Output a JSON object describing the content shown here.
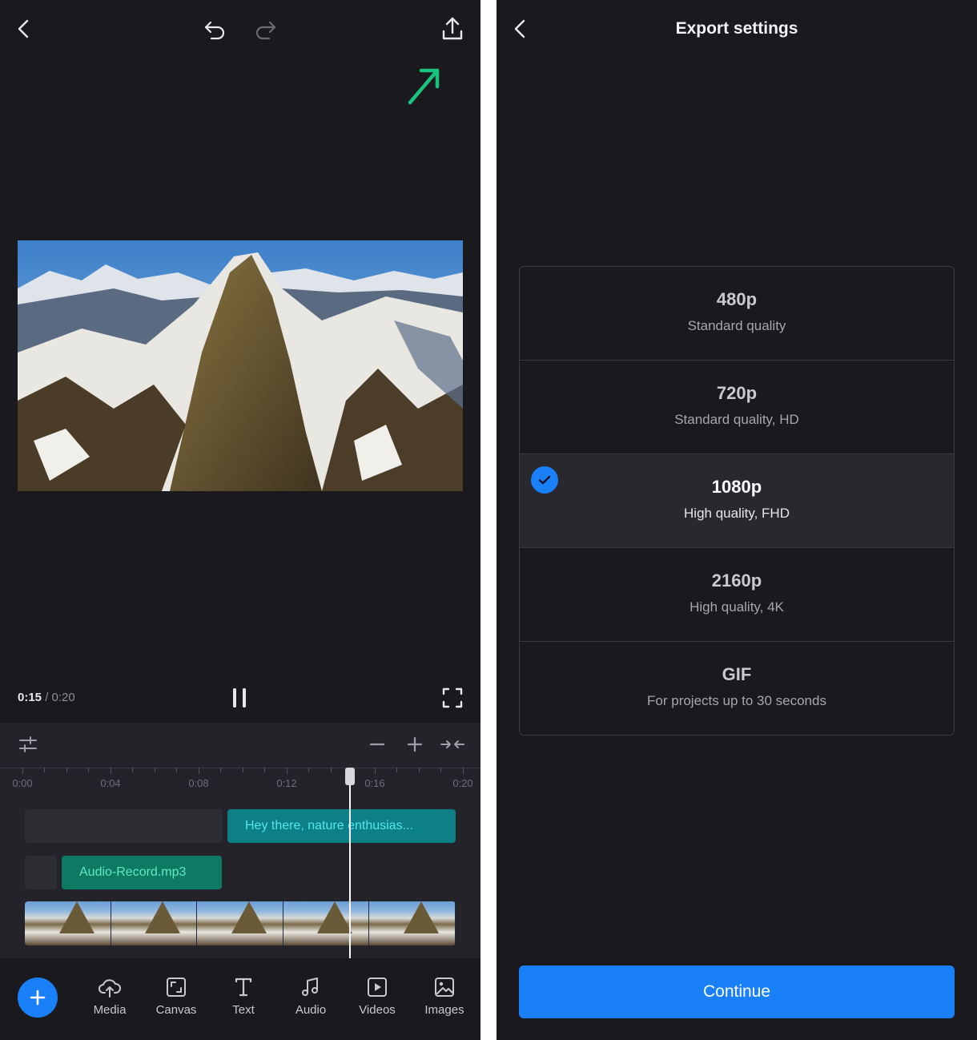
{
  "editor": {
    "time": {
      "current": "0:15",
      "separator": " / ",
      "total": "0:20"
    },
    "ruler": [
      "0:00",
      "0:04",
      "0:08",
      "0:12",
      "0:16",
      "0:20"
    ],
    "tracks": {
      "text_clip": "Hey there, nature enthusias...",
      "audio_clip": "Audio-Record.mp3"
    },
    "nav": [
      {
        "label": "Media",
        "icon": "upload-cloud-icon"
      },
      {
        "label": "Canvas",
        "icon": "canvas-icon"
      },
      {
        "label": "Text",
        "icon": "text-icon"
      },
      {
        "label": "Audio",
        "icon": "music-note-icon"
      },
      {
        "label": "Videos",
        "icon": "video-icon"
      },
      {
        "label": "Images",
        "icon": "image-icon"
      }
    ],
    "colors": {
      "accent": "#1a80f7",
      "annotation_arrow": "#19c37d"
    }
  },
  "export": {
    "title": "Export settings",
    "options": [
      {
        "name": "480p",
        "desc": "Standard quality",
        "selected": false
      },
      {
        "name": "720p",
        "desc": "Standard quality, HD",
        "selected": false
      },
      {
        "name": "1080p",
        "desc": "High quality, FHD",
        "selected": true
      },
      {
        "name": "2160p",
        "desc": "High quality, 4K",
        "selected": false
      },
      {
        "name": "GIF",
        "desc": "For projects up to 30 seconds",
        "selected": false
      }
    ],
    "continue_label": "Continue"
  }
}
